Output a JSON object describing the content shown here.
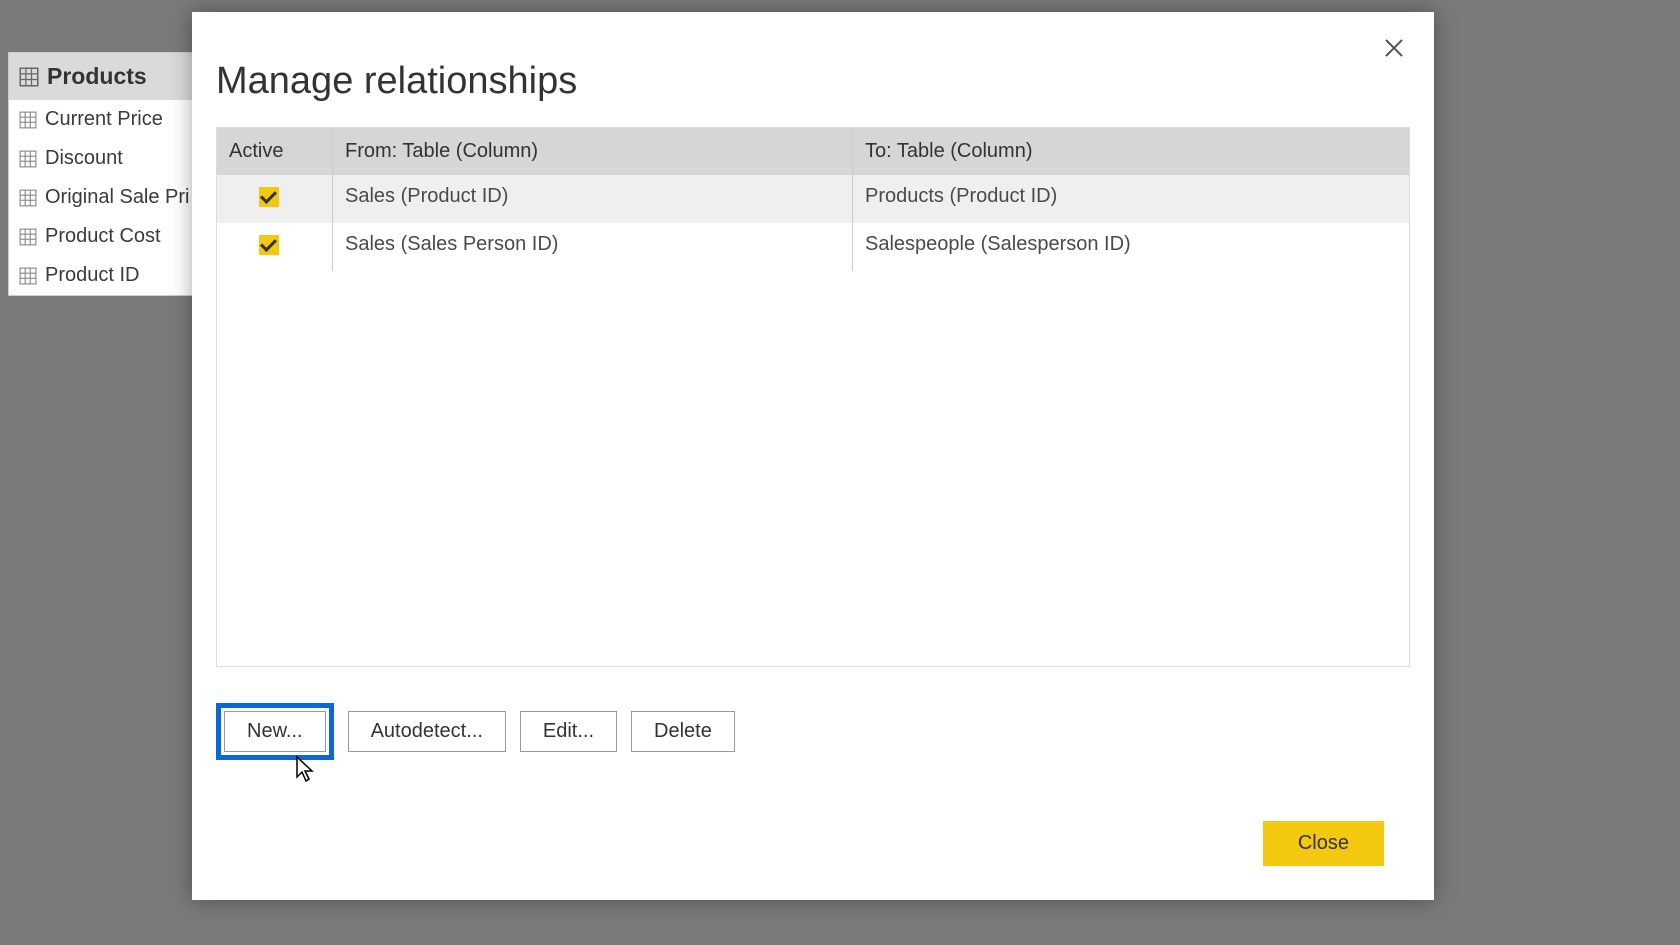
{
  "sidebar": {
    "table_name": "Products",
    "fields": [
      "Current Price",
      "Discount",
      "Original Sale Pri",
      "Product Cost",
      "Product ID"
    ]
  },
  "dialog": {
    "title": "Manage relationships",
    "columns": {
      "active": "Active",
      "from": "From: Table (Column)",
      "to": "To: Table (Column)"
    },
    "rows": [
      {
        "active": true,
        "from": "Sales (Product ID)",
        "to": "Products (Product ID)"
      },
      {
        "active": true,
        "from": "Sales (Sales Person ID)",
        "to": "Salespeople (Salesperson ID)"
      }
    ],
    "buttons": {
      "new": "New...",
      "autodetect": "Autodetect...",
      "edit": "Edit...",
      "delete": "Delete",
      "close": "Close"
    }
  }
}
